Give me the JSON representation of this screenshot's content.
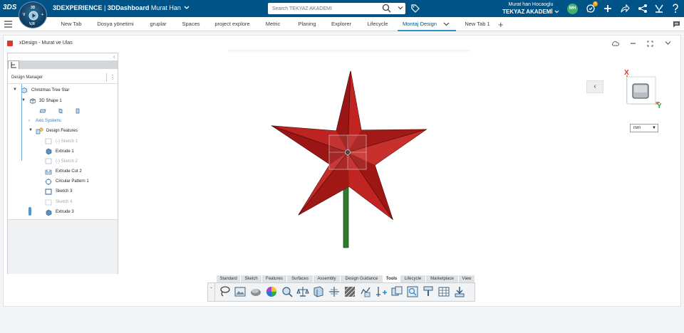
{
  "topbar": {
    "logo": "3DS",
    "compass_top": "3D",
    "compass_left": "V",
    "compass_right": "+",
    "compass_bottom": "V,R",
    "brand_main": "3DEXPERIENCE",
    "brand_sep": " | ",
    "brand_app": "3DDashboard",
    "brand_user": " Murat Han",
    "search_placeholder": "Search TEKYAZ AKADEMI",
    "user_name": "Murat han Hocaoglu",
    "user_org": "TEKYAZ AKADEMİ",
    "avatar_initials": "MH",
    "notification_count": "9"
  },
  "tabs": [
    {
      "label": "New Tab"
    },
    {
      "label": "Dosya yönetimi"
    },
    {
      "label": "gruplar"
    },
    {
      "label": "Spaces"
    },
    {
      "label": "project explore"
    },
    {
      "label": "Metric"
    },
    {
      "label": "Planing"
    },
    {
      "label": "Explorer"
    },
    {
      "label": "Lifecycle"
    },
    {
      "label": "Montaj Design"
    },
    {
      "label": "New Tab 1"
    }
  ],
  "app": {
    "title": "xDesign - Murat ve Ulas"
  },
  "panel": {
    "title": "Design Manager",
    "tree": [
      {
        "label": "Christmas Tree Star"
      },
      {
        "label": "3D Shape 1"
      },
      {
        "label": "Axis Systems"
      },
      {
        "label": "Design Features"
      },
      {
        "label": "(-) Sketch 1"
      },
      {
        "label": "Extrude 1"
      },
      {
        "label": "(-) Sketch 2"
      },
      {
        "label": "Extrude Cut 2"
      },
      {
        "label": "Circular Pattern 1"
      },
      {
        "label": "Sketch 3"
      },
      {
        "label": "Sketch 4"
      },
      {
        "label": "Extrude 3"
      }
    ]
  },
  "viewport": {
    "axis_x": "X",
    "axis_y": "Y",
    "unit": "mm",
    "colors": {
      "star": "#b01c1a",
      "stem": "#2f7a2c"
    }
  },
  "action_bar": {
    "tabs": [
      {
        "label": "Standard"
      },
      {
        "label": "Sketch"
      },
      {
        "label": "Features"
      },
      {
        "label": "Surfaces"
      },
      {
        "label": "Assembly"
      },
      {
        "label": "Design Guidance"
      },
      {
        "label": "Tools"
      },
      {
        "label": "Lifecycle"
      },
      {
        "label": "Marketplace"
      },
      {
        "label": "View"
      }
    ],
    "active_tab": "Tools",
    "tools": [
      "lasso-icon",
      "image-icon",
      "shading-icon",
      "color-wheel-icon",
      "measure-icon",
      "mass-properties-icon",
      "section-view-icon",
      "compare-icon",
      "hatch-icon",
      "check-icon",
      "add-point-icon",
      "interference-icon",
      "zoom-area-icon",
      "paint-icon",
      "table-icon",
      "export-icon"
    ]
  }
}
